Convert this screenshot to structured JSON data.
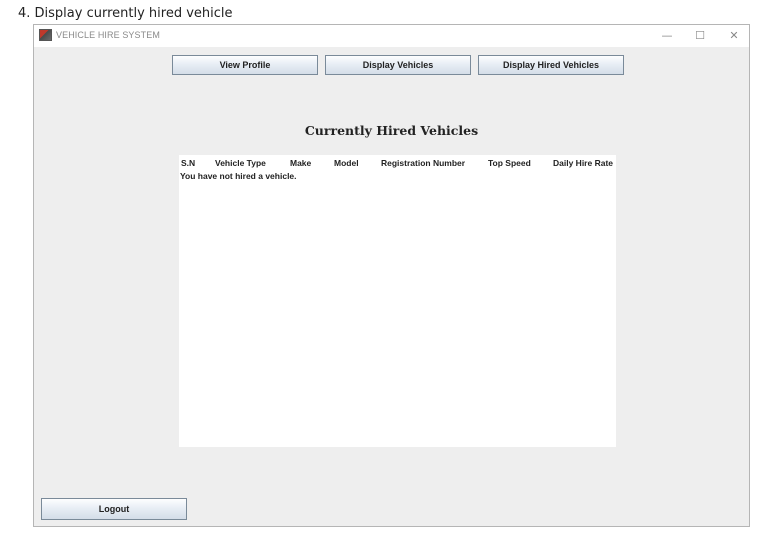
{
  "document": {
    "heading": "4. Display currently hired vehicle"
  },
  "window": {
    "title": "VEHICLE HIRE SYSTEM",
    "controls": {
      "minimize": "—",
      "maximize": "☐",
      "close": "✕"
    },
    "icon": "app-icon"
  },
  "toolbar": {
    "view_profile_label": "View Profile",
    "display_vehicles_label": "Display Vehicles",
    "display_hired_label": "Display Hired Vehicles"
  },
  "main": {
    "title": "Currently Hired Vehicles",
    "table": {
      "columns": [
        "S.N",
        "Vehicle Type",
        "Make",
        "Model",
        "Registration Number",
        "Top Speed",
        "Daily Hire Rate"
      ],
      "empty_message": "You have not hired a vehicle."
    }
  },
  "footer": {
    "logout_label": "Logout"
  }
}
